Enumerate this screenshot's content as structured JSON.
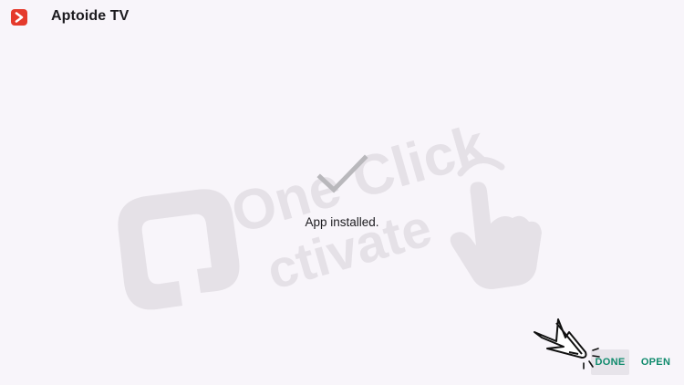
{
  "header": {
    "app_title": "Aptoide TV",
    "icon": "aptoide-logo-icon"
  },
  "main": {
    "status_icon": "checkmark-icon",
    "status_text": "App installed."
  },
  "watermark": {
    "line1": "One Click",
    "line2": "ctivate",
    "icon": "tap-hand-icon"
  },
  "actions": {
    "done_label": "DONE",
    "open_label": "OPEN",
    "pointer_icon": "arrow-pointer-icon"
  },
  "colors": {
    "background": "#f8f5fa",
    "accent": "#0f8a6c",
    "brand": "#e53a2c"
  }
}
